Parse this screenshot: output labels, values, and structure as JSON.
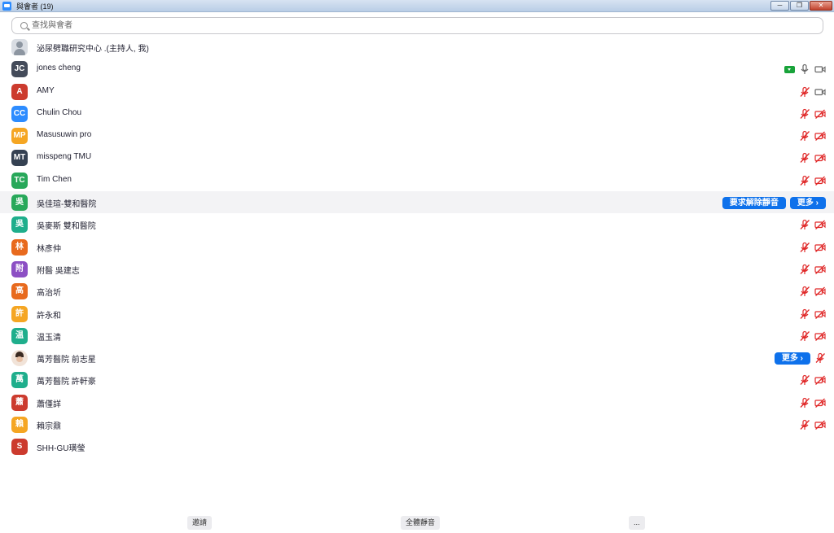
{
  "window": {
    "title": "與會者 (19)",
    "min": "─",
    "max": "❐",
    "close": "✕"
  },
  "search": {
    "placeholder": "查找與會者"
  },
  "participants": [
    {
      "name": "泌尿劈職研究中心 .(主持人, 我)",
      "avatar": "",
      "avatar_type": "img",
      "color": "#d9dde3",
      "status": []
    },
    {
      "name": "jones cheng",
      "avatar": "JC",
      "color": "#444b5a",
      "status": [
        "badge",
        "mic",
        "video"
      ]
    },
    {
      "name": "AMY",
      "avatar": "A",
      "color": "#cc3b2e",
      "status": [
        "mic-muted",
        "video"
      ]
    },
    {
      "name": "Chulin Chou",
      "avatar": "CC",
      "color": "#2d8cff",
      "status": [
        "mic-muted",
        "video-off"
      ]
    },
    {
      "name": "Masusuwin pro",
      "avatar": "MP",
      "color": "#f5a623",
      "status": [
        "mic-muted",
        "video-off"
      ]
    },
    {
      "name": "misspeng TMU",
      "avatar": "MT",
      "color": "#354152",
      "status": [
        "mic-muted",
        "video-off"
      ]
    },
    {
      "name": "Tim Chen",
      "avatar": "TC",
      "color": "#28a85a",
      "status": [
        "mic-muted",
        "video-off"
      ]
    },
    {
      "name": "吳佳瑄-雙和醫院",
      "avatar": "吳",
      "color": "#28a85a",
      "highlight": true,
      "buttons": [
        "要求解除靜音",
        "更多 ›"
      ],
      "status": []
    },
    {
      "name": "吳麥斯 雙和醫院",
      "avatar": "吳",
      "color": "#1fae8c",
      "status": [
        "mic-muted",
        "video-off"
      ]
    },
    {
      "name": "林彥仲",
      "avatar": "林",
      "color": "#e86a1e",
      "status": [
        "mic-muted",
        "video-off"
      ]
    },
    {
      "name": "附醫 吳建志",
      "avatar": "附",
      "color": "#8c4fc4",
      "status": [
        "mic-muted",
        "video-off"
      ]
    },
    {
      "name": "高治圻",
      "avatar": "高",
      "color": "#e86a1e",
      "status": [
        "mic-muted",
        "video-off"
      ]
    },
    {
      "name": "許永和",
      "avatar": "許",
      "color": "#f5a623",
      "status": [
        "mic-muted",
        "video-off"
      ]
    },
    {
      "name": "温玉清",
      "avatar": "温",
      "color": "#1fae8c",
      "status": [
        "mic-muted",
        "video-off"
      ]
    },
    {
      "name": "萬芳醫院 前志星",
      "avatar": "",
      "avatar_type": "photo",
      "color": "#f1e3d8",
      "buttons": [
        "更多 ›"
      ],
      "status": [
        "mic-muted"
      ]
    },
    {
      "name": "萬芳醫院 許軒豪",
      "avatar": "萬",
      "color": "#1fae8c",
      "status": [
        "mic-muted",
        "video-off"
      ]
    },
    {
      "name": "蕭僅詳",
      "avatar": "蕭",
      "color": "#cc3b2e",
      "status": [
        "mic-muted",
        "video-off"
      ]
    },
    {
      "name": "賴宗鼐",
      "avatar": "賴",
      "color": "#f5a623",
      "status": [
        "mic-muted",
        "video-off"
      ]
    },
    {
      "name": "SHH-GU璜瑩",
      "avatar": "S",
      "color": "#cc3b2e",
      "status": []
    }
  ],
  "footer": {
    "invite": "邀請",
    "mute_all": "全體靜音",
    "more": "..."
  }
}
